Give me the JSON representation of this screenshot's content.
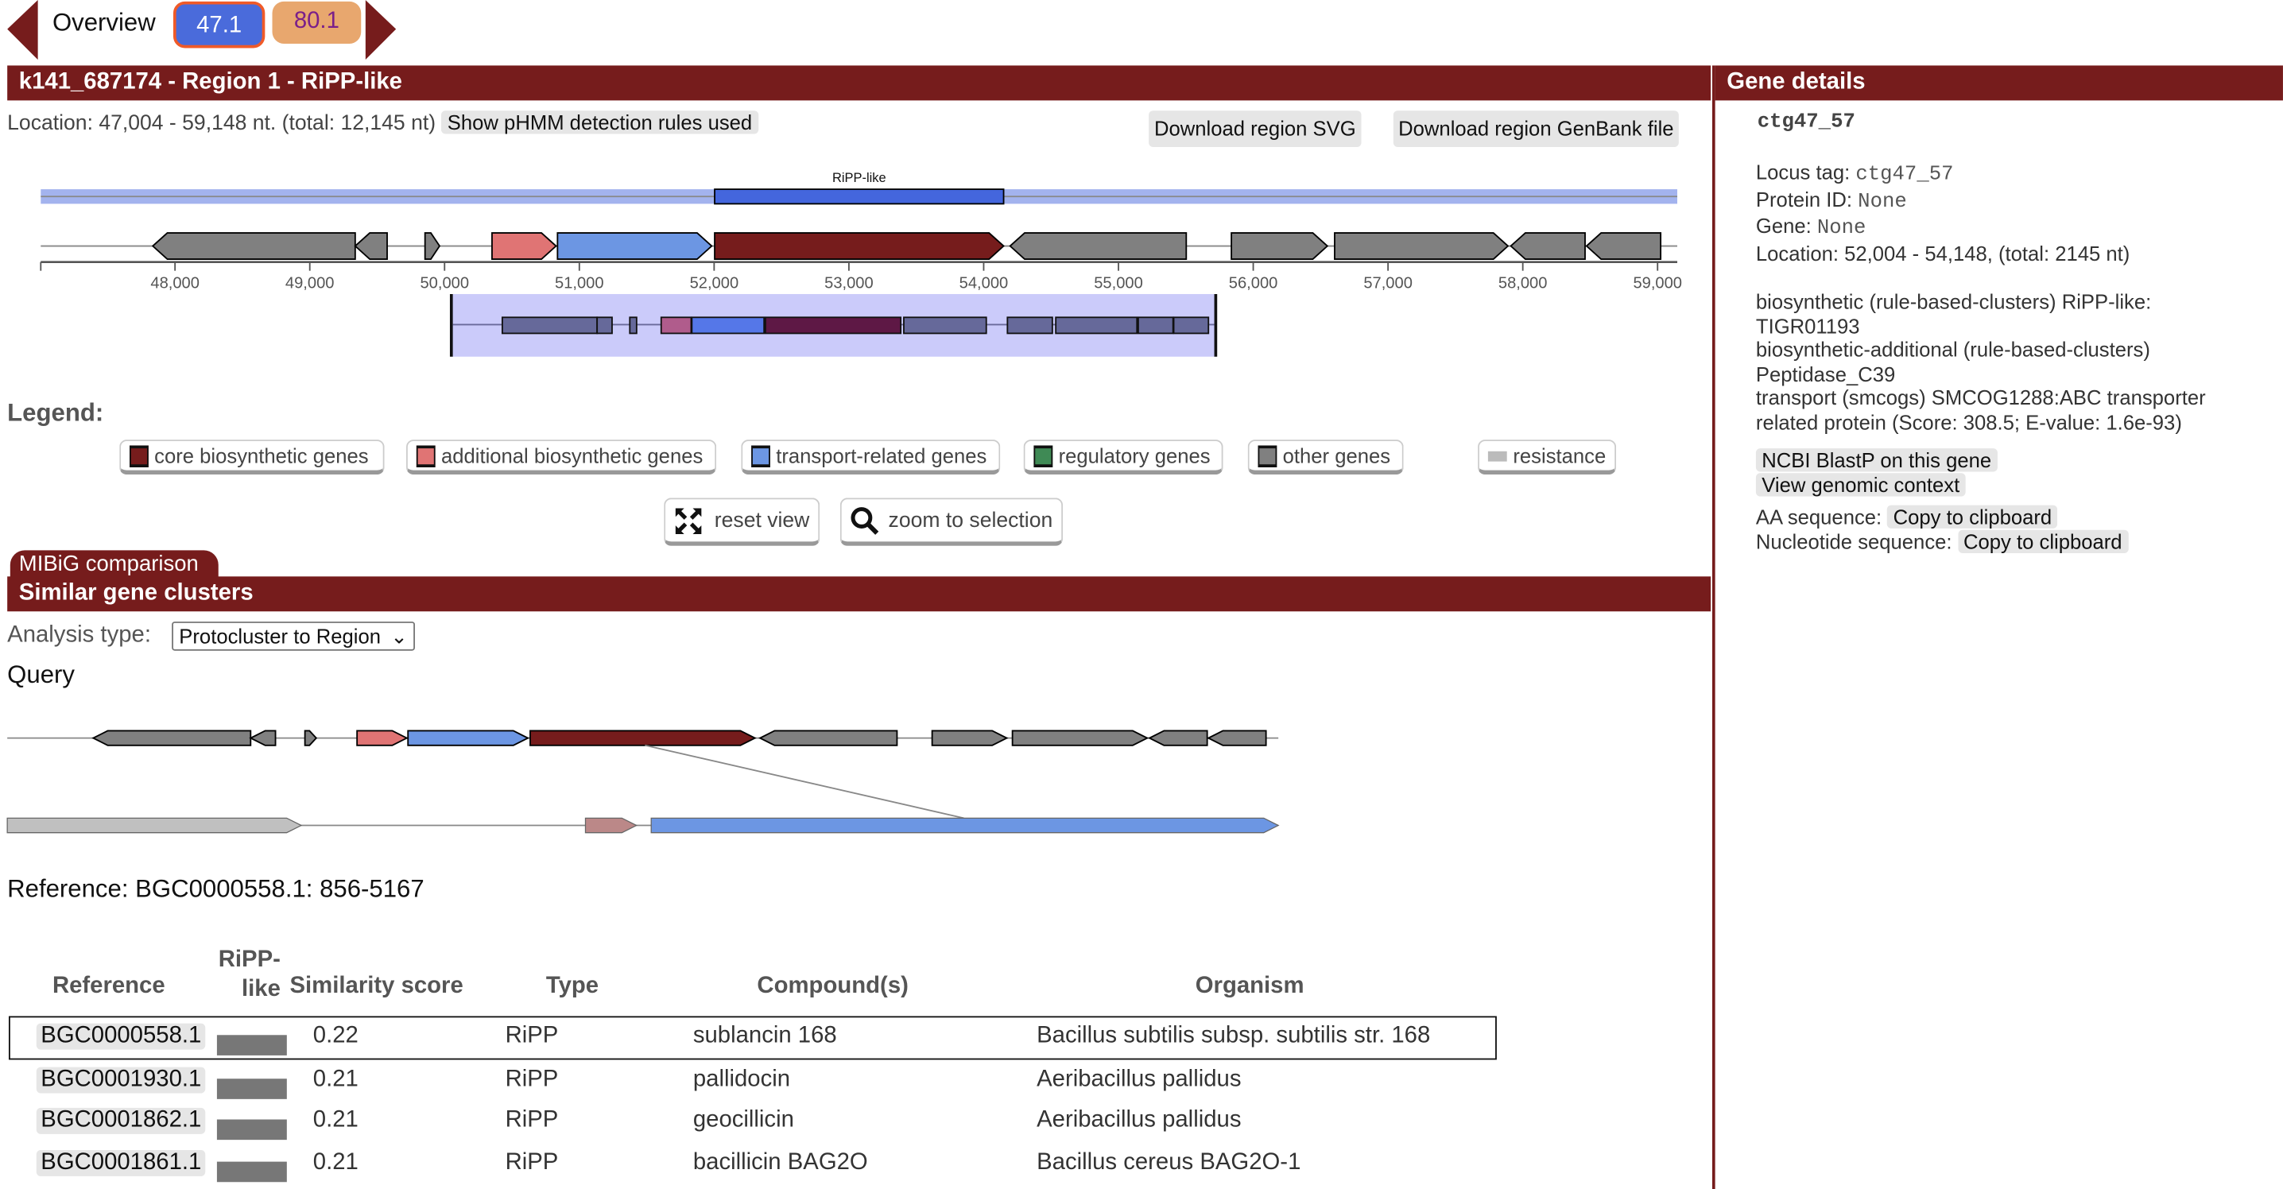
{
  "nav": {
    "overview_label": "Overview",
    "regions": [
      {
        "label": "47.1",
        "color": "#4a6bdb",
        "active": true
      },
      {
        "label": "80.1",
        "color": "#e8a76e",
        "active": false
      }
    ]
  },
  "region": {
    "title": "k141_687174 - Region 1 - RiPP-like",
    "location": "Location: 47,004 - 59,148 nt. (total: 12,145 nt)",
    "phmm_button": "Show pHMM detection rules used",
    "download_svg": "Download region SVG",
    "download_genbank": "Download region GenBank file",
    "range": [
      47004,
      59148
    ],
    "protocluster": {
      "label": "RiPP-like",
      "start": 52004,
      "end": 54148,
      "color": "#4466dd"
    },
    "ticks": [
      "48,000",
      "49,000",
      "50,000",
      "51,000",
      "52,000",
      "53,000",
      "54,000",
      "55,000",
      "56,000",
      "57,000",
      "58,000",
      "59,000"
    ],
    "tick_values": [
      48000,
      49000,
      50000,
      51000,
      52000,
      53000,
      54000,
      55000,
      56000,
      57000,
      58000,
      59000
    ],
    "genes": [
      {
        "start": 47835,
        "end": 49337,
        "strand": -1,
        "type": "other"
      },
      {
        "start": 49337,
        "end": 49574,
        "strand": -1,
        "type": "other"
      },
      {
        "start": 49855,
        "end": 49963,
        "strand": 1,
        "type": "other"
      },
      {
        "start": 50352,
        "end": 50827,
        "strand": 1,
        "type": "additional"
      },
      {
        "start": 50838,
        "end": 51982,
        "strand": 1,
        "type": "transport"
      },
      {
        "start": 52004,
        "end": 54148,
        "strand": 1,
        "type": "core"
      },
      {
        "start": 54196,
        "end": 55503,
        "strand": -1,
        "type": "other"
      },
      {
        "start": 55838,
        "end": 56550,
        "strand": 1,
        "type": "other"
      },
      {
        "start": 56604,
        "end": 57890,
        "strand": 1,
        "type": "other"
      },
      {
        "start": 57911,
        "end": 58462,
        "strand": -1,
        "type": "other"
      },
      {
        "start": 58473,
        "end": 59023,
        "strand": -1,
        "type": "other"
      }
    ]
  },
  "colors": {
    "core": "#761c1c",
    "additional": "#e07474",
    "transport": "#6c96e3",
    "regulatory": "#3f8a55",
    "other": "#808080",
    "resistance": "#bbbbbb",
    "header": "#761c1c"
  },
  "legend": {
    "title": "Legend:",
    "items": [
      {
        "label": "core biosynthetic genes",
        "type": "core"
      },
      {
        "label": "additional biosynthetic genes",
        "type": "additional"
      },
      {
        "label": "transport-related genes",
        "type": "transport"
      },
      {
        "label": "regulatory genes",
        "type": "regulatory"
      },
      {
        "label": "other genes",
        "type": "other"
      },
      {
        "label": "resistance",
        "type": "resistance"
      }
    ],
    "reset_view": "reset view",
    "zoom_selection": "zoom to selection"
  },
  "gene_details": {
    "title": "Gene details",
    "name": "ctg47_57",
    "locus_label": "Locus tag: ",
    "locus": "ctg47_57",
    "protein_label": "Protein ID: ",
    "protein": "None",
    "gene_label": "Gene: ",
    "gene": "None",
    "location": "Location: 52,004 - 54,148, (total: 2145 nt)",
    "annotations": [
      "biosynthetic (rule-based-clusters) RiPP-like:",
      "TIGR01193",
      "biosynthetic-additional (rule-based-clusters)",
      "Peptidase_C39",
      "transport (smcogs) SMCOG1288:ABC transporter",
      "related protein (Score: 308.5; E-value: 1.6e-93)"
    ],
    "blastp": "NCBI BlastP on this gene",
    "context": "View genomic context",
    "aa_label": "AA sequence: ",
    "nt_label": "Nucleotide sequence: ",
    "copy": "Copy to clipboard"
  },
  "mibig": {
    "tab": "MIBiG comparison",
    "title": "Similar gene clusters",
    "analysis_label": "Analysis type:",
    "analysis_value": "Protocluster to Region",
    "query_label": "Query",
    "reference_label": "Reference: BGC0000558.1: 856-5167",
    "reference_range": [
      856,
      5167
    ],
    "reference_genes": [
      {
        "start": 856,
        "end": 1853,
        "strand": 1,
        "color": "#c0c0c0"
      },
      {
        "start": 2817,
        "end": 2990,
        "strand": 1,
        "color": "#bb8888"
      },
      {
        "start": 3040,
        "end": 5167,
        "strand": 1,
        "color": "#6c96e3"
      }
    ],
    "table": {
      "headers": [
        "Reference",
        "RiPP-\nlike",
        "Similarity score",
        "Type",
        "Compound(s)",
        "Organism"
      ],
      "rows": [
        {
          "ref": "BGC0000558.1",
          "score": "0.22",
          "type": "RiPP",
          "compound": "sublancin 168",
          "organism": "Bacillus subtilis subsp. subtilis str. 168",
          "selected": true
        },
        {
          "ref": "BGC0001930.1",
          "score": "0.21",
          "type": "RiPP",
          "compound": "pallidocin",
          "organism": "Aeribacillus pallidus",
          "selected": false
        },
        {
          "ref": "BGC0001862.1",
          "score": "0.21",
          "type": "RiPP",
          "compound": "geocillicin",
          "organism": "Aeribacillus pallidus",
          "selected": false
        },
        {
          "ref": "BGC0001861.1",
          "score": "0.21",
          "type": "RiPP",
          "compound": "bacillicin BAG2O",
          "organism": "Bacillus cereus BAG2O-1",
          "selected": false
        }
      ]
    }
  }
}
